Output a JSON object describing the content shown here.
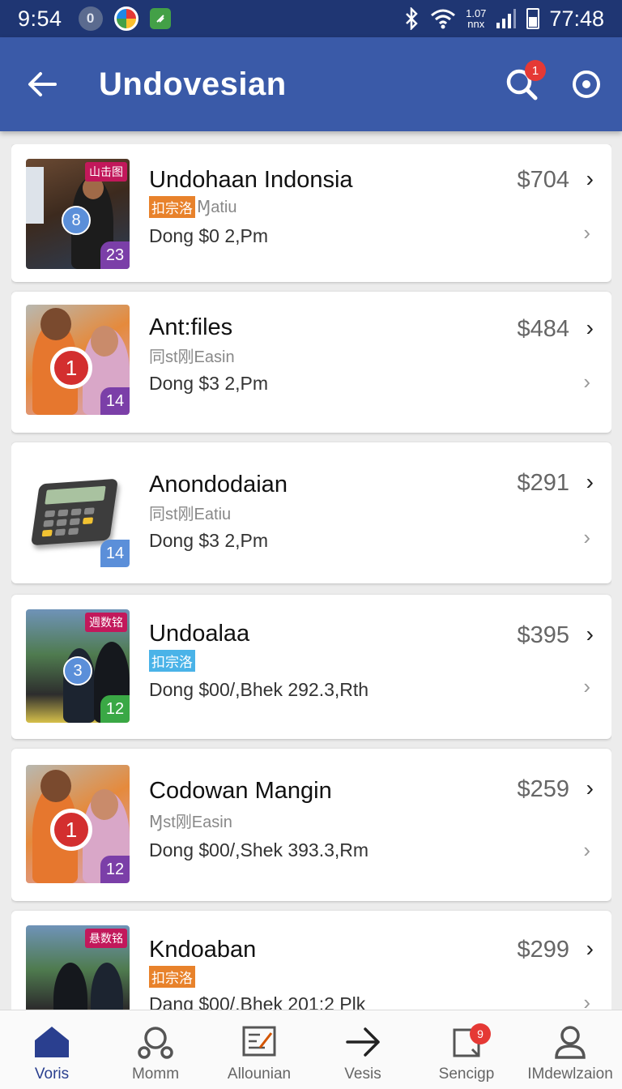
{
  "status_bar": {
    "time": "9:54",
    "notif_count": "0",
    "network_top": "1.07",
    "network_bottom": "nnx",
    "clock": "77:48"
  },
  "app_bar": {
    "title": "Undovesian",
    "search_badge": "1"
  },
  "items": [
    {
      "title": "Undohaan Indonsia",
      "tag": "扣宗洛",
      "tag_suffix": "Ɱatiu",
      "tag_color": "#e8822b",
      "subtitle": "Dong $0 2,Pm",
      "price": "$704",
      "thumb_label": "山击图",
      "dot_badge": "8",
      "count": "23",
      "count_color": "#7b3fa8"
    },
    {
      "title": "Ant:files",
      "tag": "",
      "tag_suffix": "同st刚Easin",
      "tag_color": "",
      "subtitle": "Dong $3 2,Pm",
      "price": "$484",
      "thumb_label": "",
      "dot_badge": "1",
      "count": "14",
      "count_color": "#7b3fa8"
    },
    {
      "title": "Anondodaian",
      "tag": "",
      "tag_suffix": "同st刚Eatiu",
      "tag_color": "",
      "subtitle": "Dong $3 2,Pm",
      "price": "$291",
      "thumb_label": "",
      "dot_badge": "",
      "count": "14",
      "count_color": "#5b8fd9"
    },
    {
      "title": "Undoalaa",
      "tag": "扣宗洛",
      "tag_suffix": "",
      "tag_color": "#4ab3e8",
      "subtitle": "Dong $00/,Bhek 292.3,Rth",
      "price": "$395",
      "thumb_label": "週数铭",
      "dot_badge": "3",
      "count": "12",
      "count_color": "#3aa845"
    },
    {
      "title": "Codowan Mangin",
      "tag": "",
      "tag_suffix": "Ɱst刚Easin",
      "tag_color": "",
      "subtitle": "Dong $00/,Shek 393.3,Rm",
      "price": "$259",
      "thumb_label": "",
      "dot_badge": "1",
      "count": "12",
      "count_color": "#7b3fa8"
    },
    {
      "title": "Kndoaban",
      "tag": "扣宗洛",
      "tag_suffix": "",
      "tag_color": "#e8822b",
      "subtitle": "Dang $00/,Bhek 201:2 Plk",
      "price": "$299",
      "thumb_label": "悬数铭",
      "dot_badge": "",
      "count": "",
      "count_color": ""
    }
  ],
  "bottom_nav": [
    {
      "label": "Voris",
      "icon": "home-icon"
    },
    {
      "label": "Momm",
      "icon": "people-icon"
    },
    {
      "label": "Allounian",
      "icon": "document-icon"
    },
    {
      "label": "Vesis",
      "icon": "arrow-right-icon"
    },
    {
      "label": "Sencigp",
      "icon": "note-icon",
      "badge": "9"
    },
    {
      "label": "IMdewlzaion",
      "icon": "profile-icon"
    }
  ],
  "colors": {
    "status_bar": "#1f3673",
    "app_bar": "#3a5aa8",
    "nav_active": "#2a3f8f",
    "badge_red": "#e53935"
  }
}
